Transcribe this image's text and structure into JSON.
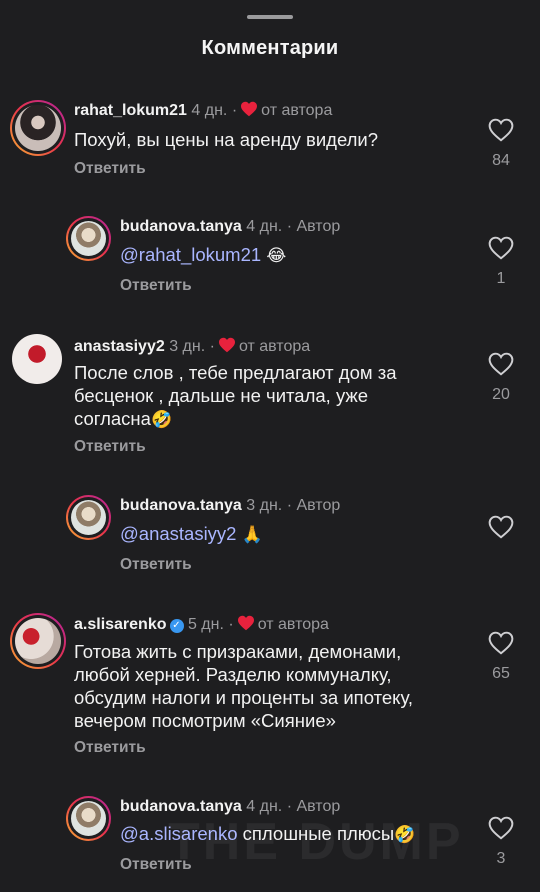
{
  "header": {
    "title": "Комментарии"
  },
  "comments": [
    {
      "user": "rahat_lokum21",
      "time": "4 дн.",
      "tag": "от автора",
      "text": "Похуй, вы цены на аренду видели?",
      "reply_label": "Ответить",
      "likes": "84"
    },
    {
      "user": "budanova.tanya",
      "time": "4 дн.",
      "tag": "Автор",
      "mention": "@rahat_lokum21",
      "text": "",
      "emoji": "😂",
      "reply_label": "Ответить",
      "likes": "1"
    },
    {
      "user": "anastasiyy2",
      "time": "3 дн.",
      "tag": "от автора",
      "line1": "После слов , тебе предлагают дом за",
      "line2": "бесценок , дальше не читала, уже",
      "line3": "согласна",
      "emoji": "🤣",
      "reply_label": "Ответить",
      "likes": "20"
    },
    {
      "user": "budanova.tanya",
      "time": "3 дн.",
      "tag": "Автор",
      "mention": "@anastasiyy2",
      "emoji": "🙏",
      "reply_label": "Ответить",
      "likes": ""
    },
    {
      "user": "a.slisarenko",
      "time": "5 дн.",
      "tag": "от автора",
      "line1": "Готова жить с призраками, демонами,",
      "line2": "любой херней. Разделю коммуналку,",
      "line3": "обсудим налоги и проценты за ипотеку,",
      "line4": "вечером посмотрим «Сияние»",
      "reply_label": "Ответить",
      "likes": "65"
    },
    {
      "user": "budanova.tanya",
      "time": "4 дн.",
      "tag": "Автор",
      "mention": "@a.slisarenko",
      "text": " сплошные плюсы",
      "emoji": "🤣",
      "reply_label": "Ответить",
      "likes": "3"
    }
  ],
  "watermark": "THE DUMP",
  "colors": {
    "background": "#1e1e20",
    "heart": "#e8223d",
    "mention": "#aab6ff",
    "verified": "#3897f0"
  }
}
